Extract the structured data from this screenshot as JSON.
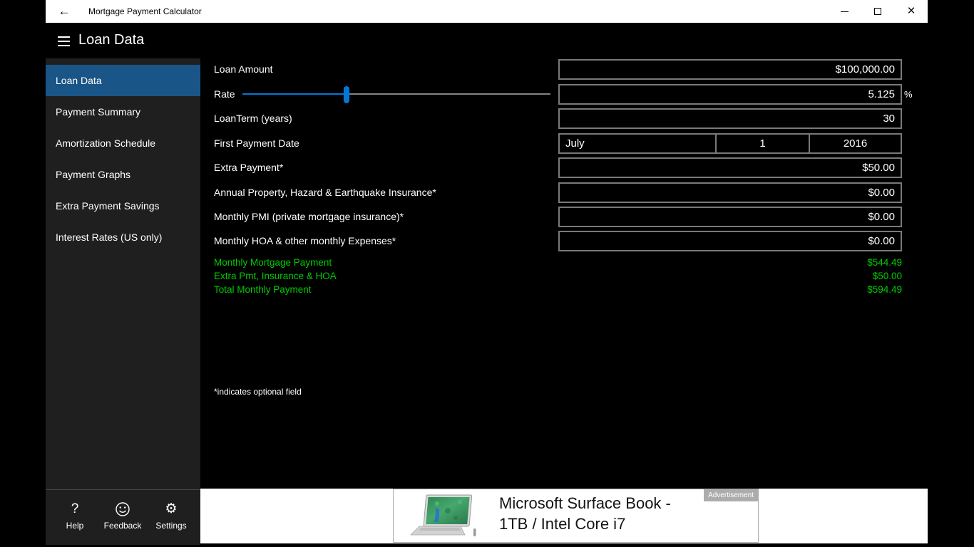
{
  "colors": {
    "accent_blue_selected": "#1A5587",
    "slider_blue": "#0078D7",
    "summary_green": "#00CC00",
    "titlebar_bg": "#FFFFFF",
    "sidebar_bg": "#1F1F1F",
    "field_border": "#797979"
  },
  "titlebar": {
    "back_icon": "←",
    "title": "Mortgage Payment Calculator",
    "close_icon": "×"
  },
  "header": {
    "title": "Loan Data"
  },
  "sidebar": {
    "items": [
      {
        "label": "Loan Data",
        "selected": true
      },
      {
        "label": "Payment Summary",
        "selected": false
      },
      {
        "label": "Amortization Schedule",
        "selected": false
      },
      {
        "label": "Payment Graphs",
        "selected": false
      },
      {
        "label": "Extra Payment Savings",
        "selected": false
      },
      {
        "label": "Interest Rates (US only)",
        "selected": false
      }
    ],
    "commands": [
      {
        "icon": "?",
        "label": "Help"
      },
      {
        "icon": "smiley-face",
        "label": "Feedback"
      },
      {
        "icon": "⚙",
        "label": "Settings"
      }
    ]
  },
  "form": {
    "loan_amount": {
      "label": "Loan Amount",
      "value": "$100,000.00"
    },
    "rate": {
      "label": "Rate",
      "value": "5.125",
      "suffix": "%",
      "slider_percent": 34
    },
    "loan_term": {
      "label": "LoanTerm (years)",
      "value": "30"
    },
    "first_payment_date": {
      "label": "First Payment Date",
      "month": "July",
      "day": "1",
      "year": "2016"
    },
    "extra_payment": {
      "label": "Extra Payment*",
      "value": "$50.00"
    },
    "insurance": {
      "label": "Annual Property, Hazard & Earthquake Insurance*",
      "value": "$0.00"
    },
    "pmi": {
      "label": "Monthly PMI (private mortgage insurance)*",
      "value": "$0.00"
    },
    "hoa": {
      "label": "Monthly HOA & other monthly Expenses*",
      "value": "$0.00"
    }
  },
  "summary": {
    "rows": [
      {
        "label": "Monthly Mortgage Payment",
        "value": "$544.49"
      },
      {
        "label": "Extra Pmt, Insurance & HOA",
        "value": "$50.00"
      },
      {
        "label": "Total Monthly Payment",
        "value": "$594.49"
      }
    ]
  },
  "note": "*indicates optional field",
  "ad": {
    "badge": "Advertisement",
    "title_line1": "Microsoft Surface Book -",
    "title_line2": "1TB / Intel Core i7"
  }
}
